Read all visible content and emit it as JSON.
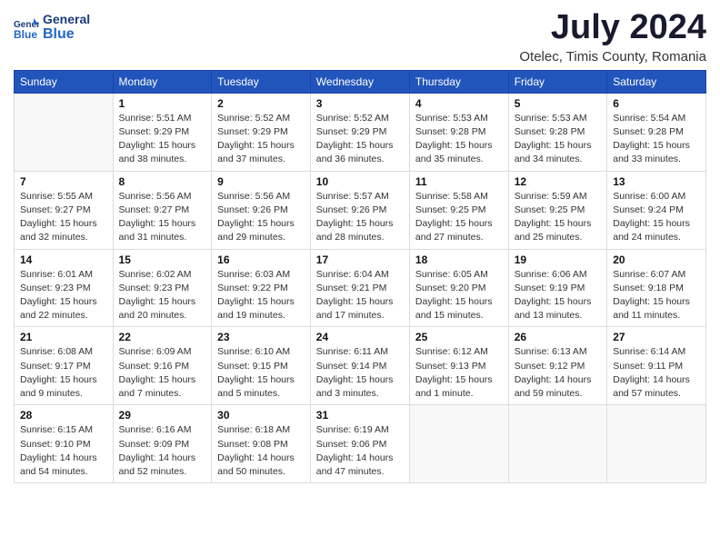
{
  "header": {
    "logo_line1": "General",
    "logo_line2": "Blue",
    "month_year": "July 2024",
    "location": "Otelec, Timis County, Romania"
  },
  "days_of_week": [
    "Sunday",
    "Monday",
    "Tuesday",
    "Wednesday",
    "Thursday",
    "Friday",
    "Saturday"
  ],
  "weeks": [
    [
      {
        "day": "",
        "info": ""
      },
      {
        "day": "1",
        "info": "Sunrise: 5:51 AM\nSunset: 9:29 PM\nDaylight: 15 hours\nand 38 minutes."
      },
      {
        "day": "2",
        "info": "Sunrise: 5:52 AM\nSunset: 9:29 PM\nDaylight: 15 hours\nand 37 minutes."
      },
      {
        "day": "3",
        "info": "Sunrise: 5:52 AM\nSunset: 9:29 PM\nDaylight: 15 hours\nand 36 minutes."
      },
      {
        "day": "4",
        "info": "Sunrise: 5:53 AM\nSunset: 9:28 PM\nDaylight: 15 hours\nand 35 minutes."
      },
      {
        "day": "5",
        "info": "Sunrise: 5:53 AM\nSunset: 9:28 PM\nDaylight: 15 hours\nand 34 minutes."
      },
      {
        "day": "6",
        "info": "Sunrise: 5:54 AM\nSunset: 9:28 PM\nDaylight: 15 hours\nand 33 minutes."
      }
    ],
    [
      {
        "day": "7",
        "info": "Sunrise: 5:55 AM\nSunset: 9:27 PM\nDaylight: 15 hours\nand 32 minutes."
      },
      {
        "day": "8",
        "info": "Sunrise: 5:56 AM\nSunset: 9:27 PM\nDaylight: 15 hours\nand 31 minutes."
      },
      {
        "day": "9",
        "info": "Sunrise: 5:56 AM\nSunset: 9:26 PM\nDaylight: 15 hours\nand 29 minutes."
      },
      {
        "day": "10",
        "info": "Sunrise: 5:57 AM\nSunset: 9:26 PM\nDaylight: 15 hours\nand 28 minutes."
      },
      {
        "day": "11",
        "info": "Sunrise: 5:58 AM\nSunset: 9:25 PM\nDaylight: 15 hours\nand 27 minutes."
      },
      {
        "day": "12",
        "info": "Sunrise: 5:59 AM\nSunset: 9:25 PM\nDaylight: 15 hours\nand 25 minutes."
      },
      {
        "day": "13",
        "info": "Sunrise: 6:00 AM\nSunset: 9:24 PM\nDaylight: 15 hours\nand 24 minutes."
      }
    ],
    [
      {
        "day": "14",
        "info": "Sunrise: 6:01 AM\nSunset: 9:23 PM\nDaylight: 15 hours\nand 22 minutes."
      },
      {
        "day": "15",
        "info": "Sunrise: 6:02 AM\nSunset: 9:23 PM\nDaylight: 15 hours\nand 20 minutes."
      },
      {
        "day": "16",
        "info": "Sunrise: 6:03 AM\nSunset: 9:22 PM\nDaylight: 15 hours\nand 19 minutes."
      },
      {
        "day": "17",
        "info": "Sunrise: 6:04 AM\nSunset: 9:21 PM\nDaylight: 15 hours\nand 17 minutes."
      },
      {
        "day": "18",
        "info": "Sunrise: 6:05 AM\nSunset: 9:20 PM\nDaylight: 15 hours\nand 15 minutes."
      },
      {
        "day": "19",
        "info": "Sunrise: 6:06 AM\nSunset: 9:19 PM\nDaylight: 15 hours\nand 13 minutes."
      },
      {
        "day": "20",
        "info": "Sunrise: 6:07 AM\nSunset: 9:18 PM\nDaylight: 15 hours\nand 11 minutes."
      }
    ],
    [
      {
        "day": "21",
        "info": "Sunrise: 6:08 AM\nSunset: 9:17 PM\nDaylight: 15 hours\nand 9 minutes."
      },
      {
        "day": "22",
        "info": "Sunrise: 6:09 AM\nSunset: 9:16 PM\nDaylight: 15 hours\nand 7 minutes."
      },
      {
        "day": "23",
        "info": "Sunrise: 6:10 AM\nSunset: 9:15 PM\nDaylight: 15 hours\nand 5 minutes."
      },
      {
        "day": "24",
        "info": "Sunrise: 6:11 AM\nSunset: 9:14 PM\nDaylight: 15 hours\nand 3 minutes."
      },
      {
        "day": "25",
        "info": "Sunrise: 6:12 AM\nSunset: 9:13 PM\nDaylight: 15 hours\nand 1 minute."
      },
      {
        "day": "26",
        "info": "Sunrise: 6:13 AM\nSunset: 9:12 PM\nDaylight: 14 hours\nand 59 minutes."
      },
      {
        "day": "27",
        "info": "Sunrise: 6:14 AM\nSunset: 9:11 PM\nDaylight: 14 hours\nand 57 minutes."
      }
    ],
    [
      {
        "day": "28",
        "info": "Sunrise: 6:15 AM\nSunset: 9:10 PM\nDaylight: 14 hours\nand 54 minutes."
      },
      {
        "day": "29",
        "info": "Sunrise: 6:16 AM\nSunset: 9:09 PM\nDaylight: 14 hours\nand 52 minutes."
      },
      {
        "day": "30",
        "info": "Sunrise: 6:18 AM\nSunset: 9:08 PM\nDaylight: 14 hours\nand 50 minutes."
      },
      {
        "day": "31",
        "info": "Sunrise: 6:19 AM\nSunset: 9:06 PM\nDaylight: 14 hours\nand 47 minutes."
      },
      {
        "day": "",
        "info": ""
      },
      {
        "day": "",
        "info": ""
      },
      {
        "day": "",
        "info": ""
      }
    ]
  ]
}
